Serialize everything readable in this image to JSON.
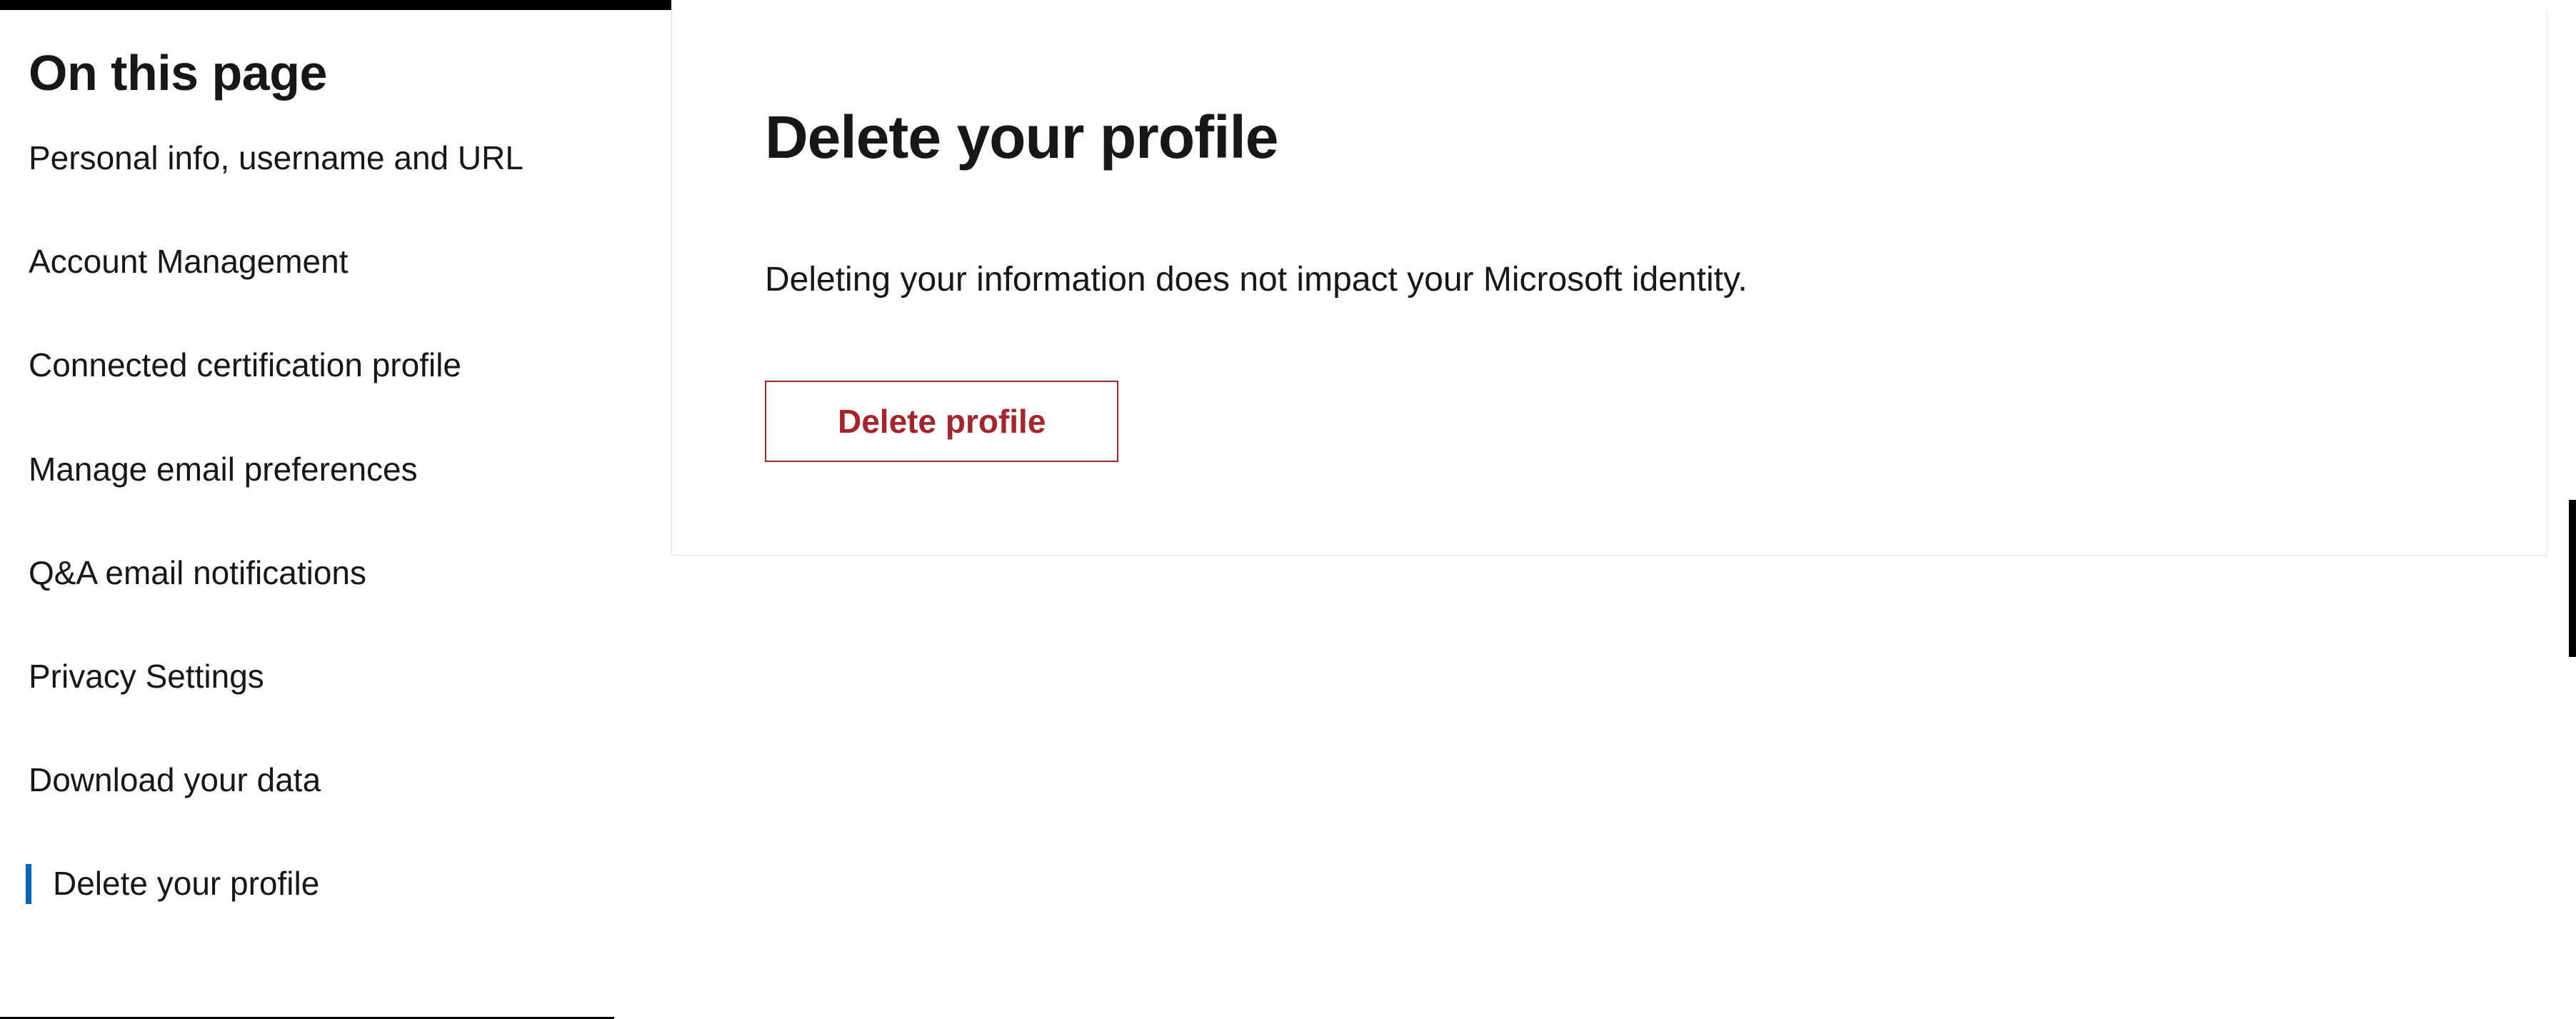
{
  "sidebar": {
    "heading": "On this page",
    "items": [
      {
        "label": "Personal info, username and URL",
        "active": false
      },
      {
        "label": "Account Management",
        "active": false
      },
      {
        "label": "Connected certification profile",
        "active": false
      },
      {
        "label": "Manage email preferences",
        "active": false
      },
      {
        "label": "Q&A email notifications",
        "active": false
      },
      {
        "label": "Privacy Settings",
        "active": false
      },
      {
        "label": "Download your data",
        "active": false
      },
      {
        "label": "Delete your profile",
        "active": true
      }
    ]
  },
  "main": {
    "heading": "Delete your profile",
    "description": "Deleting your information does not impact your Microsoft identity.",
    "delete_button_label": "Delete profile"
  }
}
